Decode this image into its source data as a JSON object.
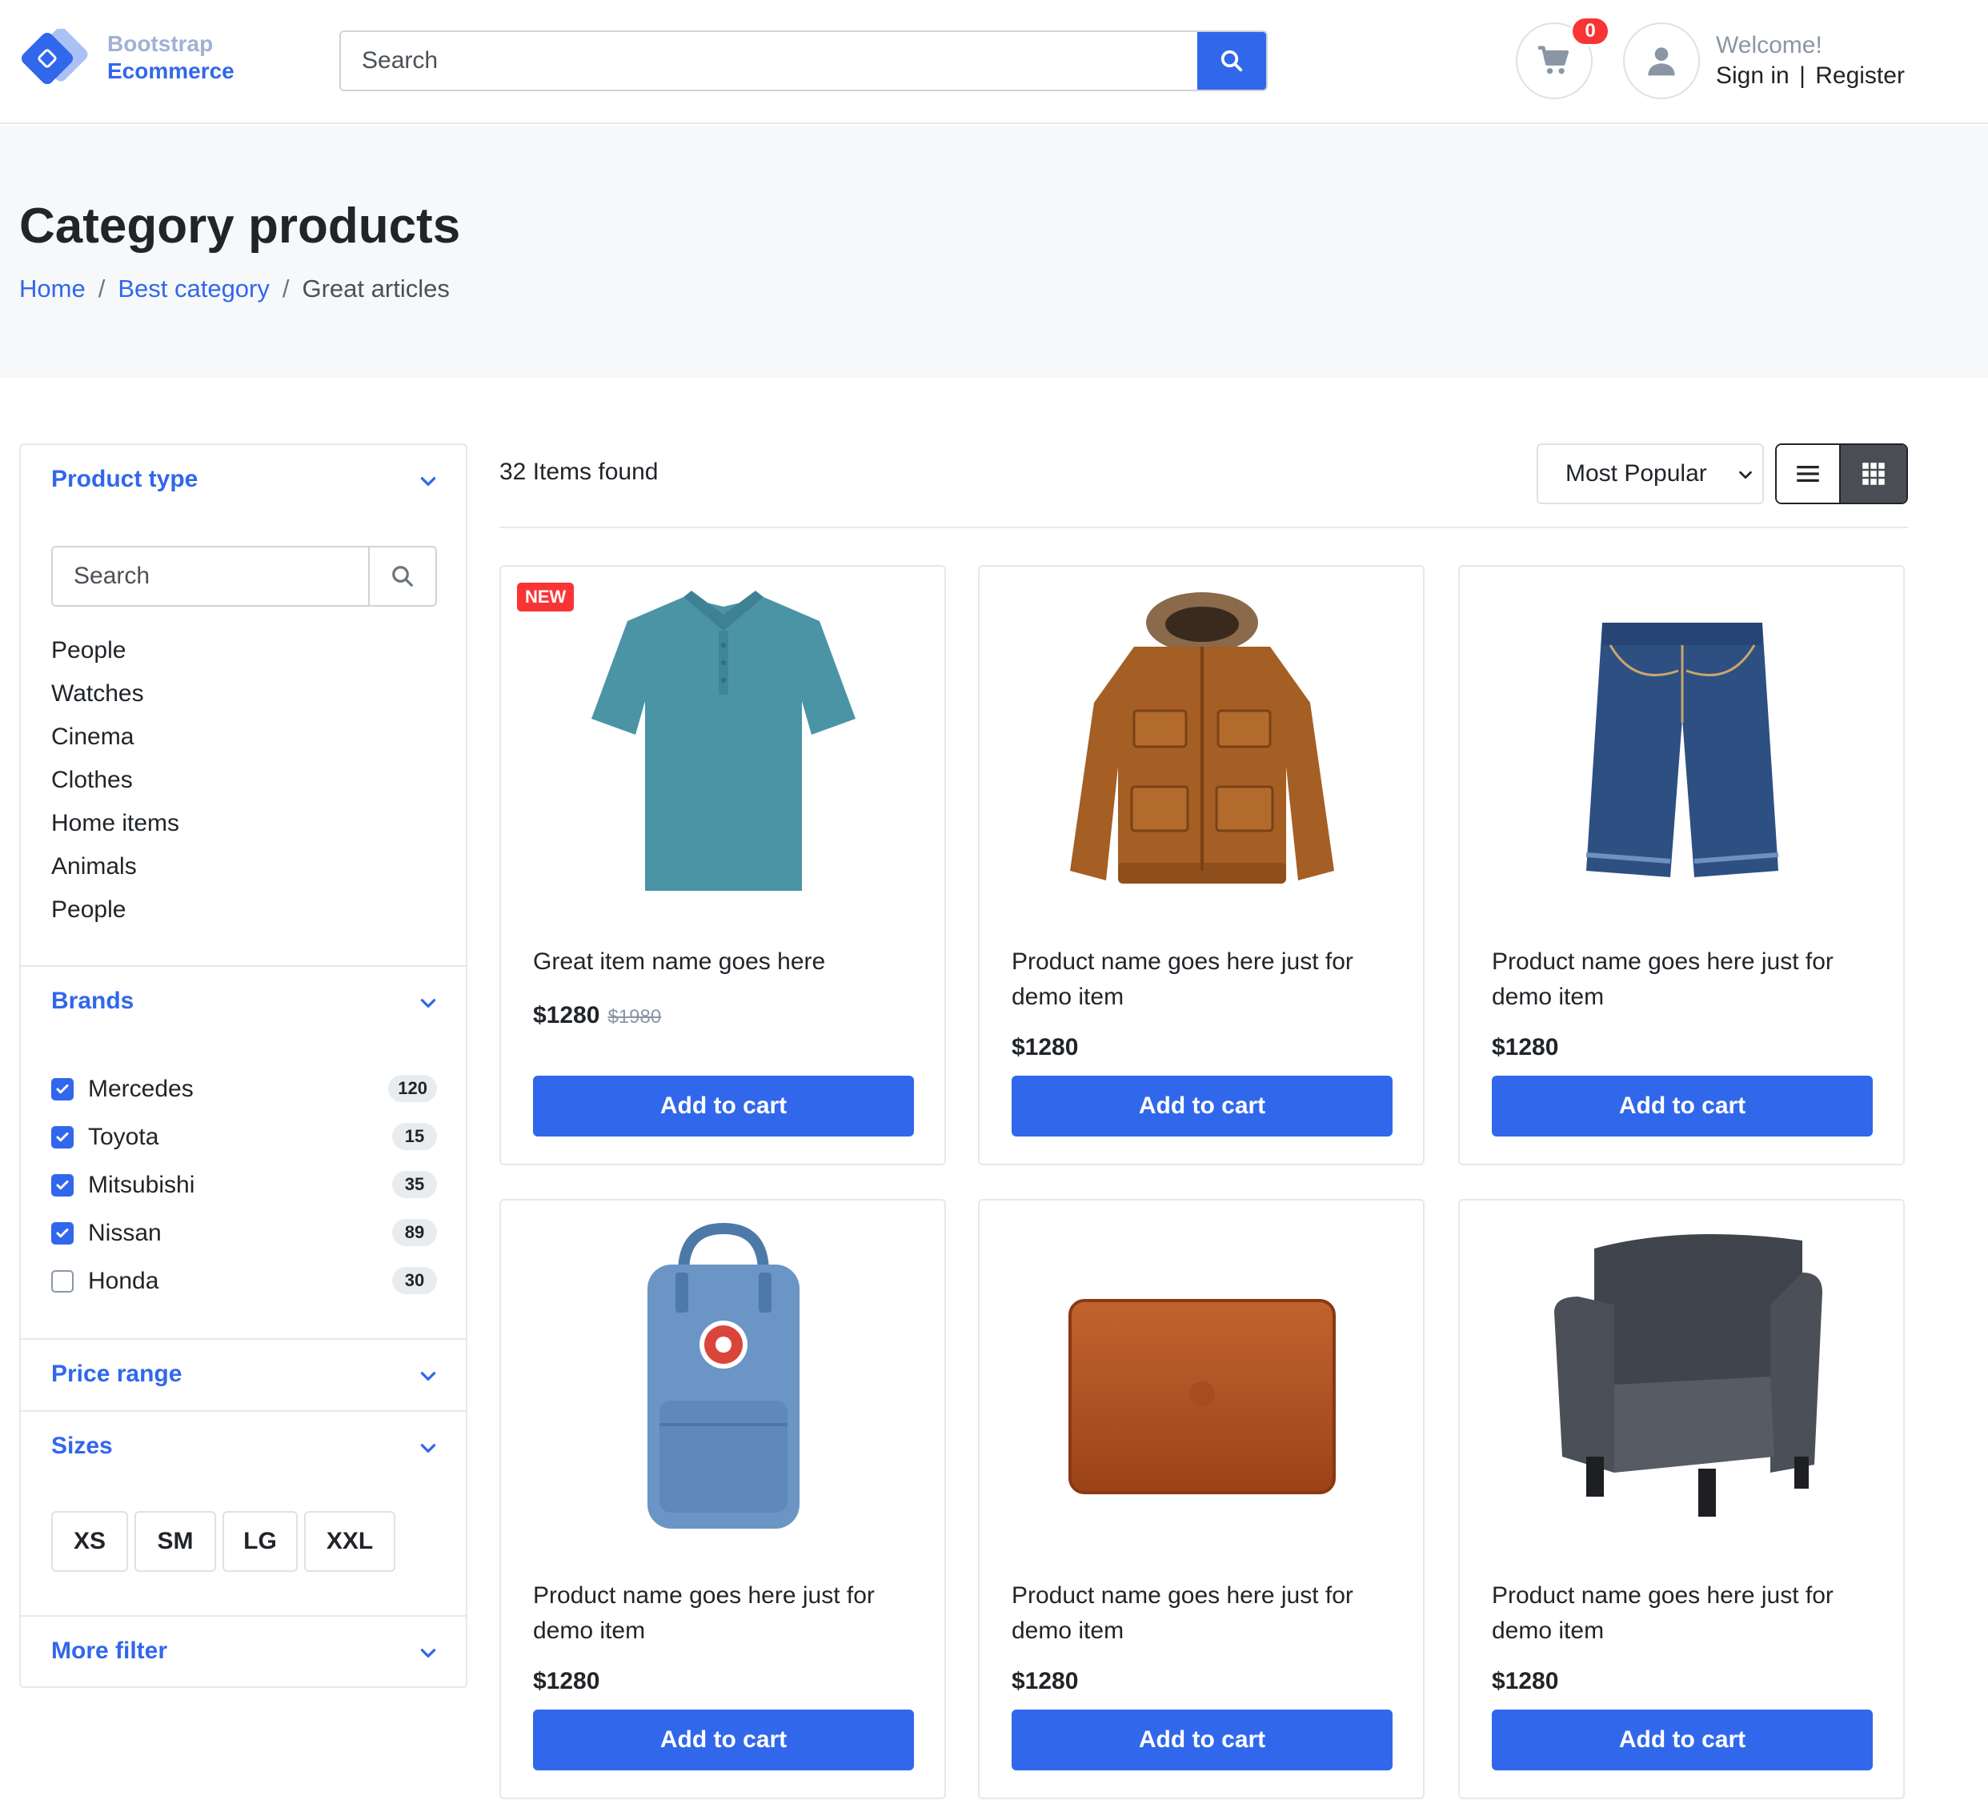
{
  "header": {
    "logo_line1": "Bootstrap",
    "logo_line2": "Ecommerce",
    "search_placeholder": "Search",
    "cart_count": "0",
    "welcome": "Welcome!",
    "sign_in": "Sign in",
    "separator": "|",
    "register": "Register",
    "accent_color": "#3167eb",
    "badge_color": "#fa3434"
  },
  "hero": {
    "title": "Category products",
    "breadcrumb": [
      {
        "label": "Home"
      },
      {
        "label": "Best category"
      },
      {
        "label": "Great articles"
      }
    ],
    "divider": "/"
  },
  "sidebar": {
    "product_type": {
      "title": "Product type",
      "search_placeholder": "Search",
      "items": [
        "People",
        "Watches",
        "Cinema",
        "Clothes",
        "Home items",
        "Animals",
        "People"
      ]
    },
    "brands": {
      "title": "Brands",
      "items": [
        {
          "label": "Mercedes",
          "count": "120",
          "checked": true
        },
        {
          "label": "Toyota",
          "count": "15",
          "checked": true
        },
        {
          "label": "Mitsubishi",
          "count": "35",
          "checked": true
        },
        {
          "label": "Nissan",
          "count": "89",
          "checked": true
        },
        {
          "label": "Honda",
          "count": "30",
          "checked": false
        }
      ]
    },
    "price_range": {
      "title": "Price range"
    },
    "sizes": {
      "title": "Sizes",
      "items": [
        "XS",
        "SM",
        "LG",
        "XXL"
      ]
    },
    "more_filter": {
      "title": "More filter"
    }
  },
  "main": {
    "items_found": "32 Items found",
    "sort_selected": "Most Popular",
    "products": [
      {
        "name": "Great item name goes here",
        "price": "$1280",
        "old_price": "$1980",
        "badge": "NEW",
        "image": "polo-shirt",
        "button": "Add to cart"
      },
      {
        "name": "Product name goes here just for demo item",
        "price": "$1280",
        "image": "brown-jacket",
        "button": "Add to cart"
      },
      {
        "name": "Product name goes here just for demo item",
        "price": "$1280",
        "image": "denim-shorts",
        "button": "Add to cart"
      },
      {
        "name": "Product name goes here just for demo item",
        "price": "$1280",
        "image": "blue-backpack",
        "button": "Add to cart"
      },
      {
        "name": "Product name goes here just for demo item",
        "price": "$1280",
        "image": "leather-sleeve",
        "button": "Add to cart"
      },
      {
        "name": "Product name goes here just for demo item",
        "price": "$1280",
        "image": "grey-armchair",
        "button": "Add to cart"
      }
    ]
  }
}
